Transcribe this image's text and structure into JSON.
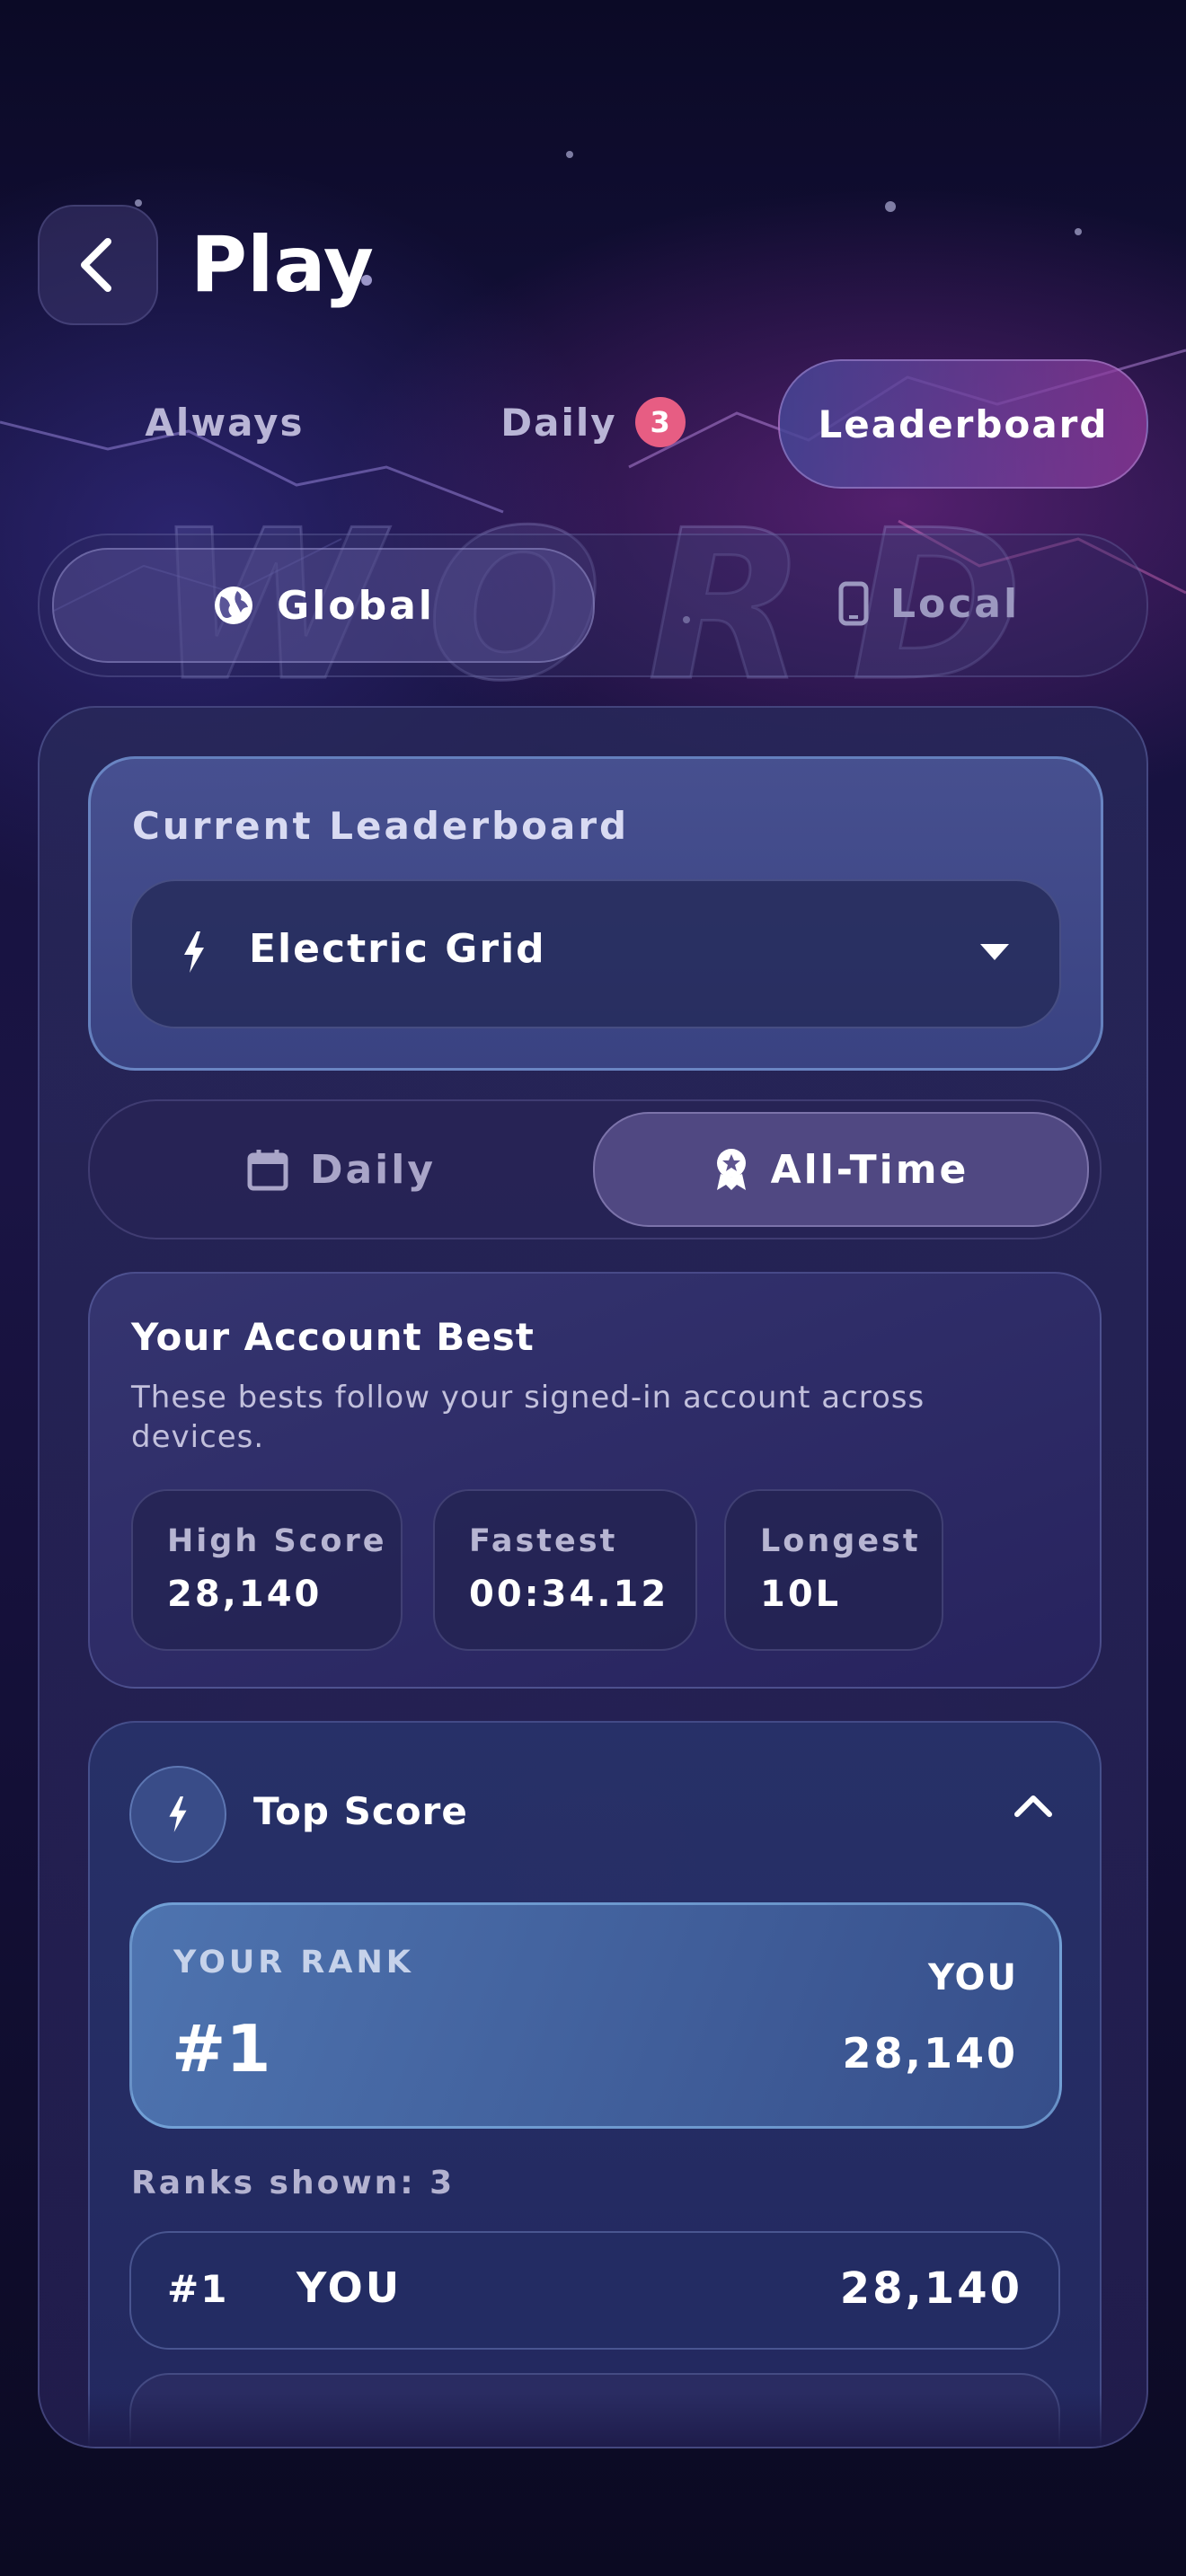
{
  "header": {
    "title": "Play",
    "back_icon": "chevron-left-icon"
  },
  "tabs": [
    {
      "label": "Always",
      "selected": false
    },
    {
      "label": "Daily",
      "badge": "3",
      "selected": false
    },
    {
      "label": "Leaderboard",
      "selected": true
    }
  ],
  "background": {
    "word_letters": [
      "W",
      "O",
      "R",
      "D"
    ]
  },
  "scope": {
    "options": [
      {
        "label": "Global",
        "icon": "globe-icon",
        "selected": true
      },
      {
        "label": "Local",
        "icon": "phone-icon",
        "selected": false
      }
    ]
  },
  "current_leaderboard": {
    "label": "Current Leaderboard",
    "selected": "Electric Grid",
    "icon": "lightning-icon"
  },
  "period": {
    "options": [
      {
        "label": "Daily",
        "icon": "calendar-icon",
        "selected": false
      },
      {
        "label": "All-Time",
        "icon": "award-ribbon-icon",
        "selected": true
      }
    ]
  },
  "account_best": {
    "title": "Your Account Best",
    "description": "These bests follow your signed-in account across devices.",
    "stats": [
      {
        "label": "High Score",
        "value": "28,140"
      },
      {
        "label": "Fastest",
        "value": "00:34.12"
      },
      {
        "label": "Longest",
        "value": "10L"
      }
    ]
  },
  "top_score": {
    "title": "Top Score",
    "your_rank": {
      "label": "YOUR RANK",
      "rank": "#1",
      "who": "YOU",
      "score": "28,140"
    },
    "ranks_shown": "Ranks shown: 3",
    "rows": [
      {
        "rank": "#1",
        "name": "YOU",
        "score": "28,140"
      }
    ]
  },
  "colors": {
    "accent_pink": "#e75d83",
    "panel_border": "#8a96d8",
    "highlight_blue": "#5078b4"
  }
}
